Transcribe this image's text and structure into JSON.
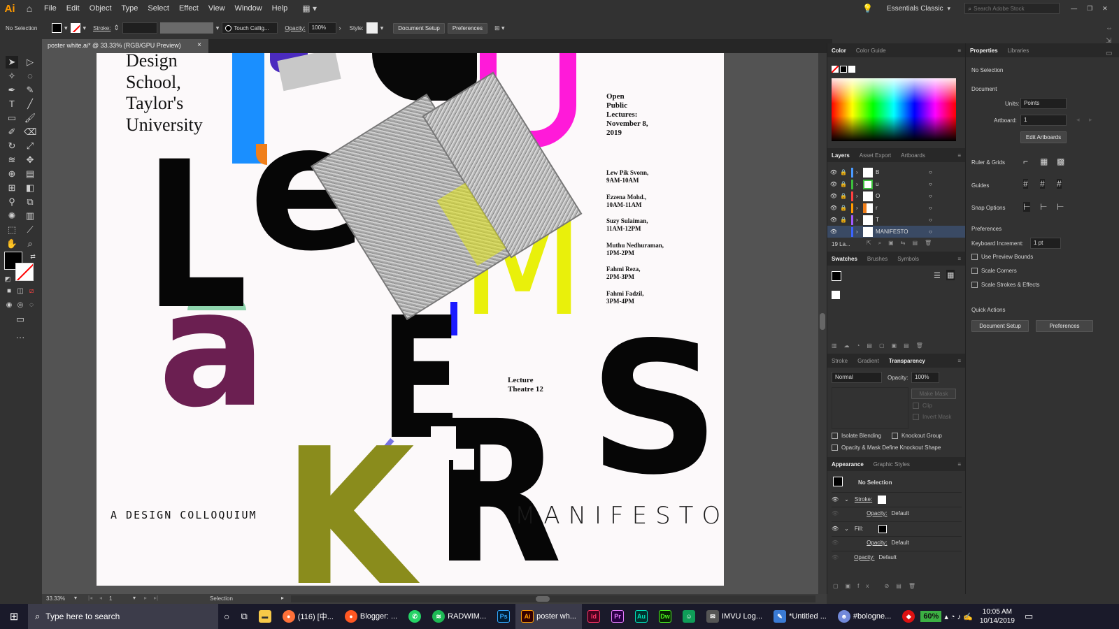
{
  "app": {
    "logo": "Ai"
  },
  "menu": [
    "File",
    "Edit",
    "Object",
    "Type",
    "Select",
    "Effect",
    "View",
    "Window",
    "Help"
  ],
  "workspace": "Essentials Classic",
  "search_placeholder": "Search Adobe Stock",
  "control": {
    "selection": "No Selection",
    "stroke_label": "Stroke:",
    "brush": "Touch Callig...",
    "opacity_label": "Opacity:",
    "opacity": "100%",
    "style_label": "Style:",
    "doc_setup": "Document Setup",
    "preferences": "Preferences"
  },
  "doc_tab": {
    "title": "poster white.ai* @ 33.33% (RGB/GPU Preview)",
    "close": "×"
  },
  "poster": {
    "school": [
      "Design",
      "School,",
      "Taylor's",
      "University"
    ],
    "open": [
      "Open",
      "Public",
      "Lectures:",
      "November 8,",
      "2019"
    ],
    "speakers": [
      {
        "name": "Lew Pik Svonn,",
        "time": "9AM-10AM"
      },
      {
        "name": "Ezzena Mohd.,",
        "time": "10AM-11AM"
      },
      {
        "name": "Suzy Sulaiman,",
        "time": "11AM-12PM"
      },
      {
        "name": "Muthu Nedhuraman,",
        "time": "1PM-2PM"
      },
      {
        "name": "Fahmi Reza,",
        "time": "2PM-3PM"
      },
      {
        "name": "Fahmi Fadzil,",
        "time": "3PM-4PM"
      }
    ],
    "venue": [
      "Lecture",
      "Theatre 12"
    ],
    "colloquium": "A DESIGN COLLOQUIUM",
    "manifesto": "MANIFESTO",
    "letters": {
      "e": "e",
      "L": "L",
      "a": "a",
      "K": "K",
      "E": "E",
      "R": "R",
      "S": "S",
      "M": "M",
      "u": "u"
    }
  },
  "status": {
    "zoom": "33.33%",
    "artboard": "1",
    "tool": "Selection"
  },
  "color_panel": {
    "tabs": [
      "Color",
      "Color Guide"
    ]
  },
  "layers_panel": {
    "tabs": [
      "Layers",
      "Asset Export",
      "Artboards"
    ],
    "rows": [
      {
        "name": "B",
        "color": "#4a9aff"
      },
      {
        "name": "u",
        "color": "#3cbf3c"
      },
      {
        "name": "O",
        "color": "#ff4040"
      },
      {
        "name": "r",
        "color": "#ff9a00"
      },
      {
        "name": "T",
        "color": "#a05aff"
      },
      {
        "name": "MANIFESTO",
        "color": "#3c64ff"
      }
    ],
    "count": "19 La..."
  },
  "swatches_panel": {
    "tabs": [
      "Swatches",
      "Brushes",
      "Symbols"
    ]
  },
  "transparency_panel": {
    "tabs": [
      "Stroke",
      "Gradient",
      "Transparency"
    ],
    "mode": "Normal",
    "opacity_label": "Opacity:",
    "opacity": "100%",
    "make_mask": "Make Mask",
    "clip": "Clip",
    "invert": "Invert Mask",
    "isolate": "Isolate Blending",
    "knockout": "Knockout Group",
    "opacity_mask": "Opacity & Mask Define Knockout Shape"
  },
  "appearance_panel": {
    "tabs": [
      "Appearance",
      "Graphic Styles"
    ],
    "title": "No Selection",
    "stroke": "Stroke:",
    "fill": "Fill:",
    "opacity_label": "Opacity:",
    "opacity_value": "Default"
  },
  "properties": {
    "tabs": [
      "Properties",
      "Libraries"
    ],
    "selection": "No Selection",
    "document": "Document",
    "units_label": "Units:",
    "units": "Points",
    "artboard_label": "Artboard:",
    "artboard": "1",
    "edit_artboards": "Edit Artboards",
    "ruler_grids": "Ruler & Grids",
    "guides": "Guides",
    "snap": "Snap Options",
    "preferences": "Preferences",
    "kb_label": "Keyboard Increment:",
    "kb_value": "1 pt",
    "use_preview": "Use Preview Bounds",
    "scale_corners": "Scale Corners",
    "scale_strokes": "Scale Strokes & Effects",
    "quick_actions": "Quick Actions",
    "doc_setup": "Document Setup",
    "prefs_btn": "Preferences"
  },
  "taskbar": {
    "search": "Type here to search",
    "apps": [
      {
        "label": "(116) [中...",
        "color": "#ff7139"
      },
      {
        "label": "Blogger: ...",
        "color": "#ff5722"
      },
      {
        "label": "",
        "color": "#25d366"
      },
      {
        "label": "RADWIM...",
        "color": "#1db954"
      },
      {
        "label": "",
        "color": "#001e36",
        "text": "Ps"
      },
      {
        "label": "poster wh...",
        "color": "#330000",
        "text": "Ai"
      },
      {
        "label": "",
        "color": "#49021f",
        "text": "Id"
      },
      {
        "label": "",
        "color": "#2a0045",
        "text": "Pr"
      },
      {
        "label": "",
        "color": "#00332f",
        "text": "Au"
      },
      {
        "label": "",
        "color": "#072401",
        "text": "Dw"
      },
      {
        "label": "",
        "color": "#0f9d58"
      },
      {
        "label": "IMVU Log...",
        "color": "#555"
      },
      {
        "label": "*Untitled ...",
        "color": "#3a7bd5"
      },
      {
        "label": "#bologne...",
        "color": "#7289da"
      }
    ],
    "battery": "60%",
    "time": "10:05 AM",
    "date": "10/14/2019"
  }
}
